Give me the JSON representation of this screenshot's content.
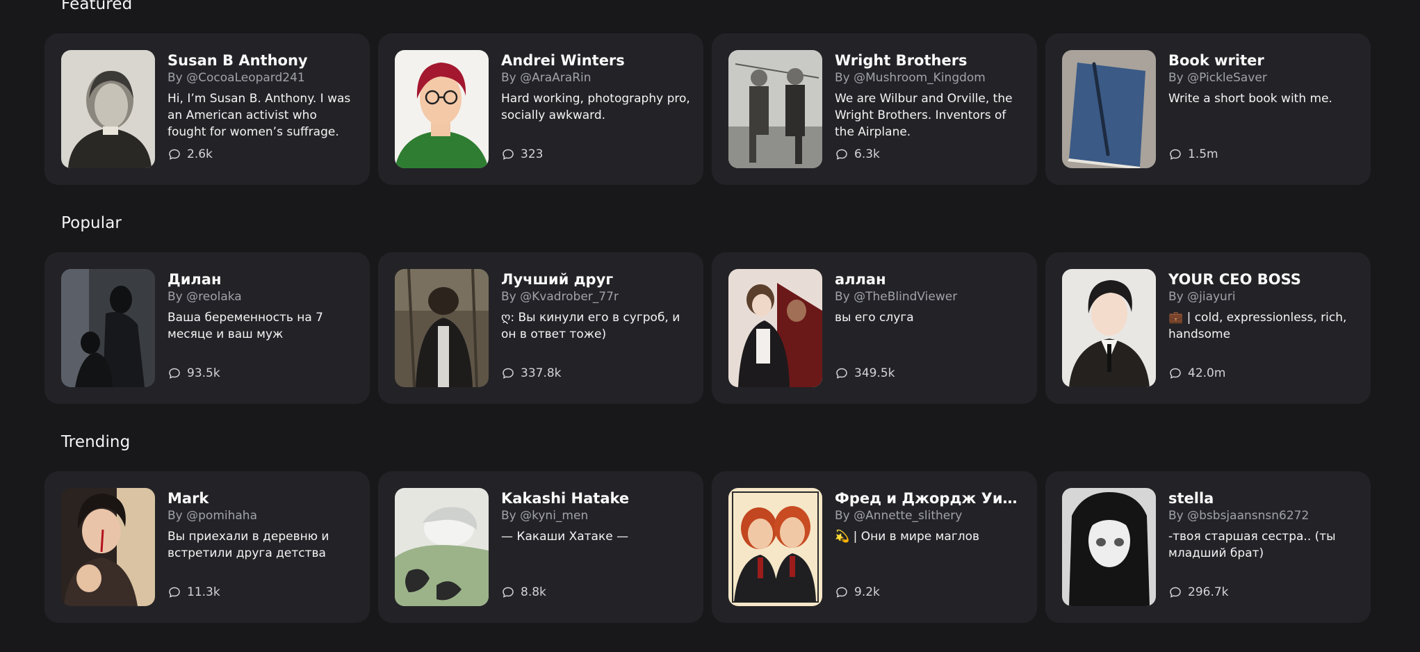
{
  "sections": [
    {
      "title": "Featured",
      "cards": [
        {
          "name": "Susan B Anthony",
          "author": "By @CocoaLeopard241",
          "description": "Hi, I’m Susan B. Anthony. I was an American activist who fought for women’s suffrage.",
          "chats": "2.6k"
        },
        {
          "name": "Andrei Winters",
          "author": "By @AraAraRin",
          "description": "Hard working, photography pro, socially awkward.",
          "chats": "323"
        },
        {
          "name": "Wright Brothers",
          "author": "By @Mushroom_Kingdom",
          "description": "We are Wilbur and Orville, the Wright Brothers. Inventors of the Airplane.",
          "chats": "6.3k"
        },
        {
          "name": "Book writer",
          "author": "By @PickleSaver",
          "description": "Write a short book with me.",
          "chats": "1.5m"
        }
      ]
    },
    {
      "title": "Popular",
      "cards": [
        {
          "name": "Дилан",
          "author": "By @reolaka",
          "description": "Ваша беременность на 7 месяце и ваш муж",
          "chats": "93.5k"
        },
        {
          "name": "Лучший друг",
          "author": "By @Kvadrober_77r",
          "description": "ღ: Вы кинули его в сугроб, и он в ответ тоже)",
          "chats": "337.8k"
        },
        {
          "name": "аллан",
          "author": "By @TheBlindViewer",
          "description": "вы его слуга",
          "chats": "349.5k"
        },
        {
          "name": "YOUR CEO BOSS",
          "author": "By @jiayuri",
          "description": "💼 | cold, expressionless, rich, handsome",
          "chats": "42.0m"
        }
      ]
    },
    {
      "title": "Trending",
      "cards": [
        {
          "name": "Mark",
          "author": "By @pomihaha",
          "description": "Вы приехали в деревню и встретили друга детства",
          "chats": "11.3k"
        },
        {
          "name": "Kakashi Hatake",
          "author": "By @kyni_men",
          "description": "— Какаши Хатаке —",
          "chats": "8.8k"
        },
        {
          "name": "Фред и Джордж Уизли",
          "author": "By @Annette_slithery",
          "description": "💫 | Они в мире маглов",
          "chats": "9.2k"
        },
        {
          "name": "stella",
          "author": "By @bsbsjaansnsn6272",
          "description": "-твоя старшая сестра.. (ты младший брат)",
          "chats": "296.7k"
        }
      ]
    }
  ]
}
